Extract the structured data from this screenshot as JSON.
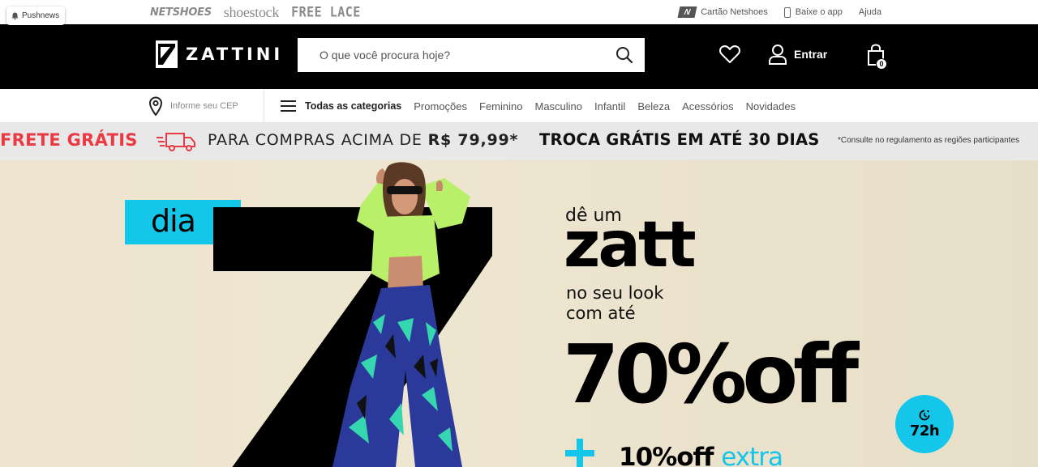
{
  "pushnews": {
    "label": "Pushnews"
  },
  "brands": {
    "netshoes": "NETSHOES",
    "shoestock": "shoestock",
    "freelace": "FREE LACE"
  },
  "toplinks": {
    "card": "Cartão Netshoes",
    "card_logo": "N",
    "app": "Baixe o app",
    "help": "Ajuda"
  },
  "header": {
    "logo_text": "ZATTINI",
    "search_placeholder": "O que você procura hoje?",
    "login_label": "Entrar",
    "cart_count": "0"
  },
  "nav": {
    "cep_label": "Informe seu CEP",
    "all_categories": "Todas as categorias",
    "items": [
      "Promoções",
      "Feminino",
      "Masculino",
      "Infantil",
      "Beleza",
      "Acessórios",
      "Novidades"
    ]
  },
  "shipping": {
    "free": "FRETE GRÁTIS",
    "condition_prefix": "PARA COMPRAS ACIMA DE ",
    "condition_value": "R$ 79,99*",
    "troca": "TROCA GRÁTIS EM ATÉ 30 DIAS",
    "note": "*Consulte no regulamento as regiões participantes"
  },
  "hero": {
    "dia": "dia",
    "de_um": "dê um",
    "zatt": "zatt",
    "look_line1": "no seu look",
    "look_line2": "com até",
    "discount": "70%off",
    "badge": "72h",
    "extra_plus": "+",
    "extra_value": "10%off ",
    "extra_word": "extra"
  },
  "colors": {
    "accent_cyan": "#13c6ea",
    "free_red": "#ea3a43",
    "header_black": "#000000"
  }
}
